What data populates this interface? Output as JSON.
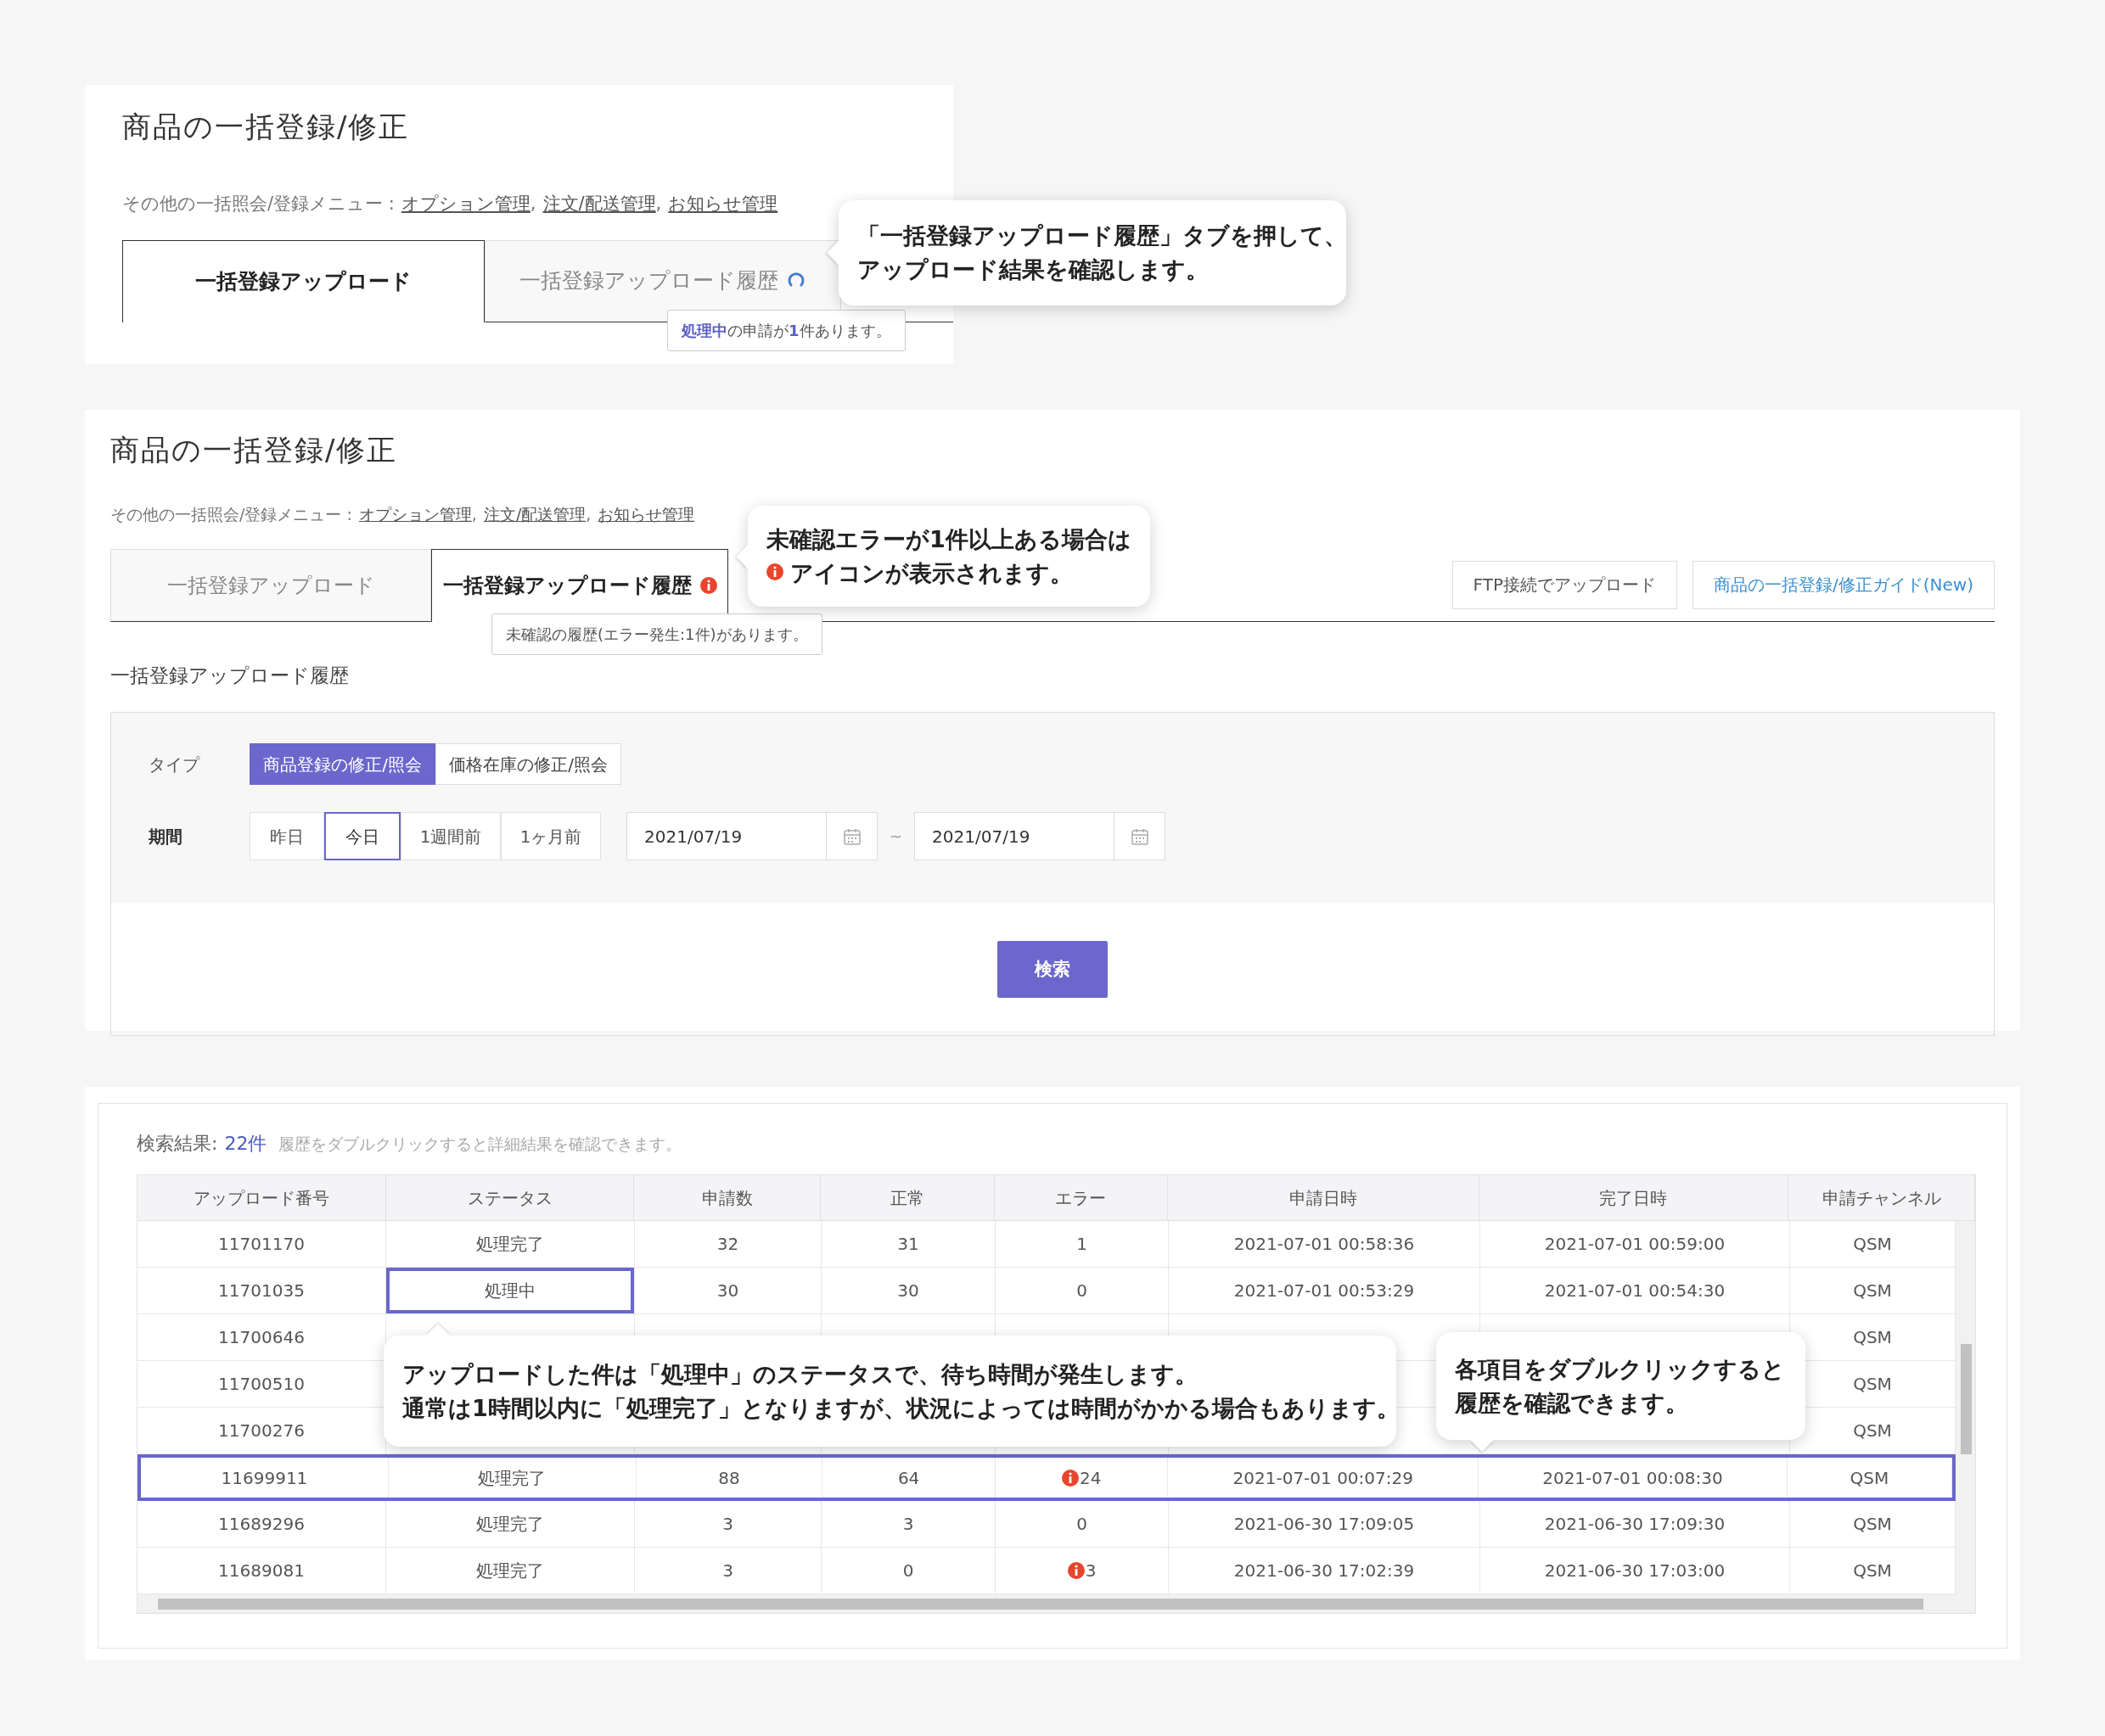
{
  "screen_1": {
    "title": "商品の一括登録/修正",
    "menu": {
      "prefix": "その他の一括照会/登録メニュー :",
      "separator": ",",
      "links": [
        "オプション管理",
        "注文/配送管理",
        "お知らせ管理"
      ]
    },
    "tabs": [
      {
        "label": "一括登録アップロード",
        "selected": true,
        "loading": false
      },
      {
        "label": "一括登録アップロード履歴",
        "selected": false,
        "loading": true
      }
    ],
    "tooltip": "**処理中**の申請が**1**件あります。"
  },
  "screen_2": {
    "title": "商品の一括登録/修正",
    "menu": {
      "prefix": "その他の一括照会/登録メニュー :",
      "separator": ",",
      "links": [
        "オプション管理",
        "注文/配送管理",
        "お知らせ管理"
      ]
    },
    "tabs": [
      {
        "label": "一括登録アップロード",
        "selected": false,
        "error": false
      },
      {
        "label": "一括登録アップロード履歴",
        "selected": true,
        "error": true
      }
    ],
    "tooltip": "未確認の履歴(エラー発生:1件)があります。",
    "buttons": [
      {
        "label": "FTP接続でアップロード",
        "kind": "plain"
      },
      {
        "label": "商品の一括登録/修正ガイド(New)",
        "kind": "link"
      }
    ],
    "section_title": "一括登録アップロード履歴",
    "filters": {
      "type_label": "タイプ",
      "types": [
        {
          "label": "商品登録の修正/照会",
          "selected": true
        },
        {
          "label": "価格在庫の修正/照会",
          "selected": false
        }
      ],
      "period_label": "期間",
      "periods": [
        {
          "label": "昨日",
          "selected": false
        },
        {
          "label": "今日",
          "selected": true
        },
        {
          "label": "1週間前",
          "selected": false
        },
        {
          "label": "1ヶ月前",
          "selected": false
        }
      ],
      "date_from": "2021/07/19",
      "range_sep": "~",
      "date_to": "2021/07/19"
    },
    "search_button": "検索"
  },
  "screen_3": {
    "results": {
      "label": "検索結果:",
      "count": "22件",
      "note": "履歴をダブルクリックすると詳細結果を確認できます。"
    },
    "table": {
      "columns": [
        "アップロード番号",
        "ステータス",
        "申請数",
        "正常",
        "エラー",
        "申請日時",
        "完了日時",
        "申請チャンネル"
      ],
      "rows": [
        {
          "cells": [
            "11701170",
            "処理完了",
            "32",
            "31",
            "1",
            "2021-07-01 00:58:36",
            "2021-07-01 00:59:00",
            "QSM"
          ],
          "row_highlighted": false,
          "status_highlighted": false,
          "error_icon": false
        },
        {
          "cells": [
            "11701035",
            "処理中",
            "30",
            "30",
            "0",
            "2021-07-01 00:53:29",
            "2021-07-01 00:54:30",
            "QSM"
          ],
          "row_highlighted": false,
          "status_highlighted": true,
          "error_icon": false
        },
        {
          "cells": [
            "11700646",
            null,
            null,
            null,
            null,
            null,
            null,
            "QSM"
          ],
          "row_highlighted": false,
          "status_highlighted": false,
          "error_icon": false
        },
        {
          "cells": [
            "11700510",
            null,
            null,
            null,
            null,
            null,
            null,
            "QSM"
          ],
          "row_highlighted": false,
          "status_highlighted": false,
          "error_icon": false
        },
        {
          "cells": [
            "11700276",
            null,
            null,
            null,
            null,
            null,
            null,
            "QSM"
          ],
          "row_highlighted": false,
          "status_highlighted": false,
          "error_icon": false
        },
        {
          "cells": [
            "11699911",
            "処理完了",
            "88",
            "64",
            "24",
            "2021-07-01 00:07:29",
            "2021-07-01 00:08:30",
            "QSM"
          ],
          "row_highlighted": true,
          "status_highlighted": false,
          "error_icon": true
        },
        {
          "cells": [
            "11689296",
            "処理完了",
            "3",
            "3",
            "0",
            "2021-06-30 17:09:05",
            "2021-06-30 17:09:30",
            "QSM"
          ],
          "row_highlighted": false,
          "status_highlighted": false,
          "error_icon": false
        },
        {
          "cells": [
            "11689081",
            "処理完了",
            "3",
            "0",
            "3",
            "2021-06-30 17:02:39",
            "2021-06-30 17:03:00",
            "QSM"
          ],
          "row_highlighted": false,
          "status_highlighted": false,
          "error_icon": true
        }
      ]
    }
  },
  "callouts": [
    {
      "lines": [
        {
          "text": "「一括登録アップロード履歴」タブを押して、",
          "icon": false
        },
        {
          "text": "アップロード結果を確認します。",
          "icon": false
        }
      ]
    },
    {
      "lines": [
        {
          "text": "未確認エラーが1件以上ある場合は",
          "icon": false
        },
        {
          "text": "アイコンが表示されます。",
          "icon": true
        }
      ]
    },
    {
      "lines": [
        {
          "text": "アップロードした件は「処理中」のステータスで、待ち時間が発生します。",
          "icon": false
        },
        {
          "text": "通常は1時間以内に「処理完了」となりますが、状況によっては時間がかかる場合もあります。",
          "icon": false
        }
      ]
    },
    {
      "lines": [
        {
          "text": "各項目をダブルクリックすると",
          "icon": false
        },
        {
          "text": "履歴を確認できます。",
          "icon": false
        }
      ]
    }
  ]
}
